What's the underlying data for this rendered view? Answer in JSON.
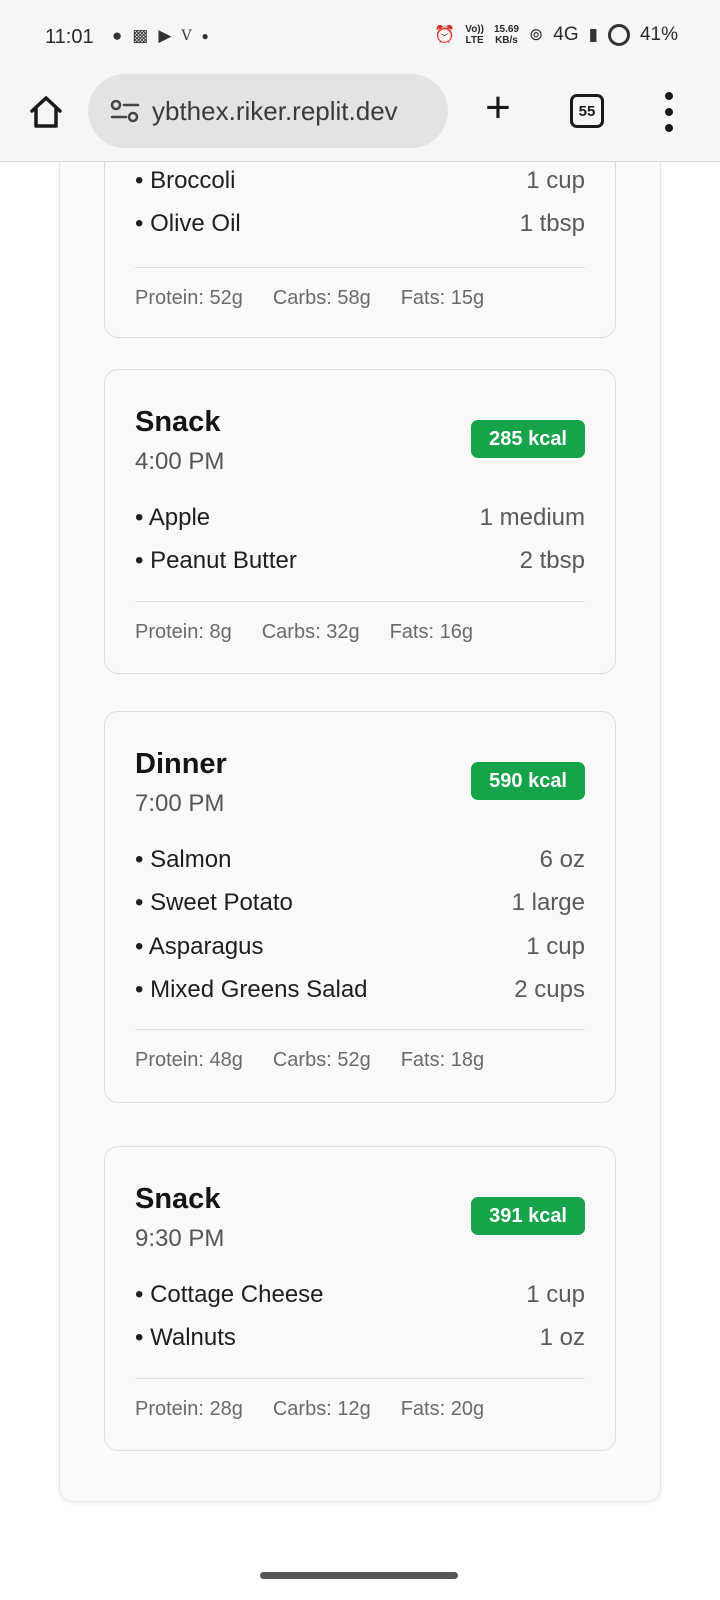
{
  "status_bar": {
    "time": "11:01",
    "carrier_mark": "V",
    "net_top": "Vo))",
    "net_bottom": "LTE",
    "speed_value": "15.69",
    "speed_unit": "KB/s",
    "network": "4G",
    "battery": "41%"
  },
  "browser": {
    "url": "ybthex.riker.replit.dev",
    "tab_count": "55"
  },
  "meals": [
    {
      "items": [
        {
          "name": "Broccoli",
          "qty": "1 cup"
        },
        {
          "name": "Olive Oil",
          "qty": "1 tbsp"
        }
      ],
      "protein": "Protein: 52g",
      "carbs": "Carbs: 58g",
      "fats": "Fats: 15g"
    },
    {
      "name": "Snack",
      "time": "4:00 PM",
      "kcal": "285 kcal",
      "items": [
        {
          "name": "Apple",
          "qty": "1 medium"
        },
        {
          "name": "Peanut Butter",
          "qty": "2 tbsp"
        }
      ],
      "protein": "Protein: 8g",
      "carbs": "Carbs: 32g",
      "fats": "Fats: 16g"
    },
    {
      "name": "Dinner",
      "time": "7:00 PM",
      "kcal": "590 kcal",
      "items": [
        {
          "name": "Salmon",
          "qty": "6 oz"
        },
        {
          "name": "Sweet Potato",
          "qty": "1 large"
        },
        {
          "name": "Asparagus",
          "qty": "1 cup"
        },
        {
          "name": "Mixed Greens Salad",
          "qty": "2 cups"
        }
      ],
      "protein": "Protein: 48g",
      "carbs": "Carbs: 52g",
      "fats": "Fats: 18g"
    },
    {
      "name": "Snack",
      "time": "9:30 PM",
      "kcal": "391 kcal",
      "items": [
        {
          "name": "Cottage Cheese",
          "qty": "1 cup"
        },
        {
          "name": "Walnuts",
          "qty": "1 oz"
        }
      ],
      "protein": "Protein: 28g",
      "carbs": "Carbs: 12g",
      "fats": "Fats: 20g"
    }
  ],
  "colors": {
    "kcal_badge": "#16a34a"
  }
}
